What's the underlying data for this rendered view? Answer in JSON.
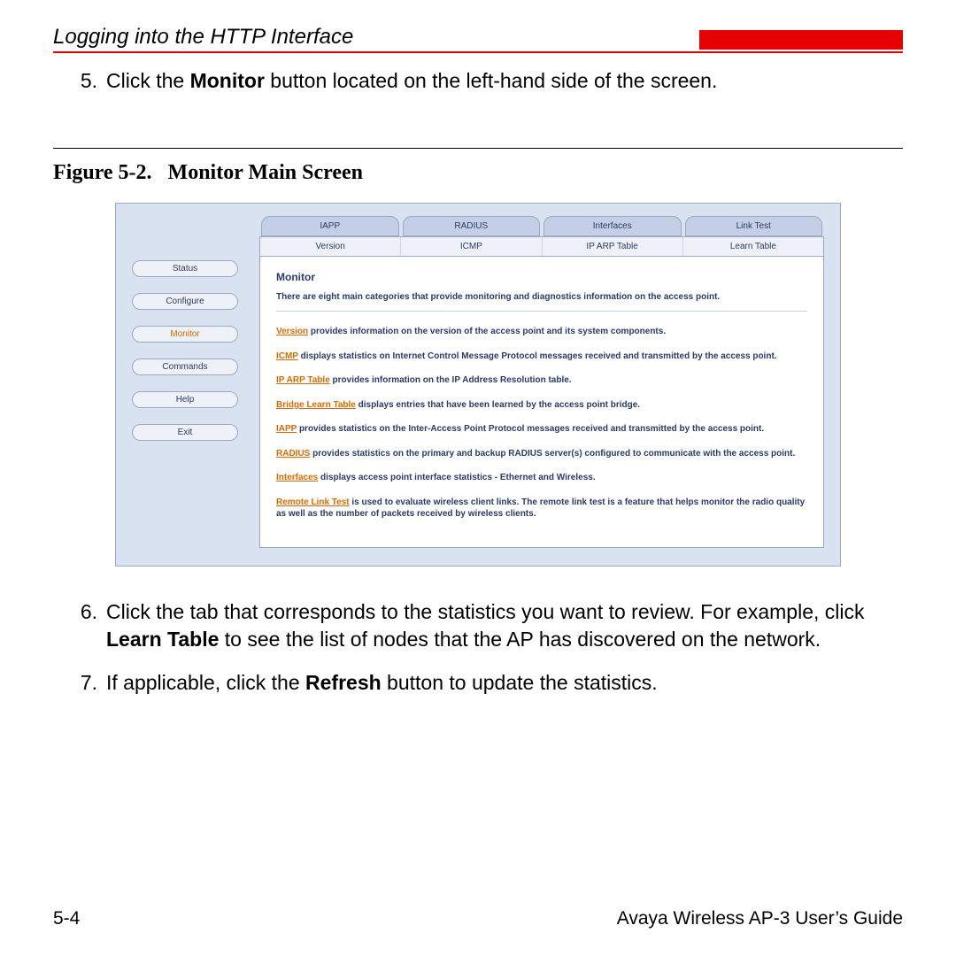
{
  "header": {
    "title": "Logging into the HTTP Interface"
  },
  "step5": {
    "num": "5.",
    "pre": "Click the ",
    "bold": "Monitor",
    "post": " button located on the left-hand side of the screen."
  },
  "figure": {
    "label": "Figure 5-2.",
    "title": "Monitor Main Screen"
  },
  "screenshot": {
    "sidebar": {
      "items": [
        {
          "label": "Status",
          "active": false
        },
        {
          "label": "Configure",
          "active": false
        },
        {
          "label": "Monitor",
          "active": true
        },
        {
          "label": "Commands",
          "active": false
        },
        {
          "label": "Help",
          "active": false
        },
        {
          "label": "Exit",
          "active": false
        }
      ]
    },
    "tabs_top": [
      "IAPP",
      "RADIUS",
      "Interfaces",
      "Link Test"
    ],
    "tabs_bottom": [
      "Version",
      "ICMP",
      "IP ARP Table",
      "Learn Table"
    ],
    "panel": {
      "heading": "Monitor",
      "intro": "There are eight main categories that provide monitoring and diagnostics information on the access point.",
      "items": [
        {
          "link": "Version",
          "text": " provides information on the version of the access point and its system components."
        },
        {
          "link": "ICMP",
          "text": " displays statistics on Internet Control Message Protocol messages received and transmitted by the access point."
        },
        {
          "link": "IP ARP Table",
          "text": " provides information on the IP Address Resolution table."
        },
        {
          "link": "Bridge Learn Table",
          "text": " displays entries that have been learned by the access point bridge."
        },
        {
          "link": "IAPP",
          "text": " provides statistics on the Inter-Access Point Protocol messages received and transmitted by the access point."
        },
        {
          "link": "RADIUS",
          "text": " provides statistics on the primary and backup RADIUS server(s) configured to communicate with the access point."
        },
        {
          "link": "Interfaces",
          "text": " displays access point interface statistics - Ethernet and Wireless."
        },
        {
          "link": "Remote Link Test",
          "text": " is used to evaluate wireless client links. The remote link test is a feature that helps monitor the radio quality as well as the number of packets received by wireless clients."
        }
      ]
    }
  },
  "step6": {
    "num": "6.",
    "parts": [
      "Click the tab that corresponds to the statistics you want to review. For example, click ",
      "Learn Table",
      " to see the list of nodes that the AP has discovered on the network."
    ]
  },
  "step7": {
    "num": "7.",
    "parts": [
      "If applicable, click the ",
      "Refresh",
      " button to update the statistics."
    ]
  },
  "footer": {
    "page": "5-4",
    "book": "Avaya Wireless AP-3 User’s Guide"
  }
}
